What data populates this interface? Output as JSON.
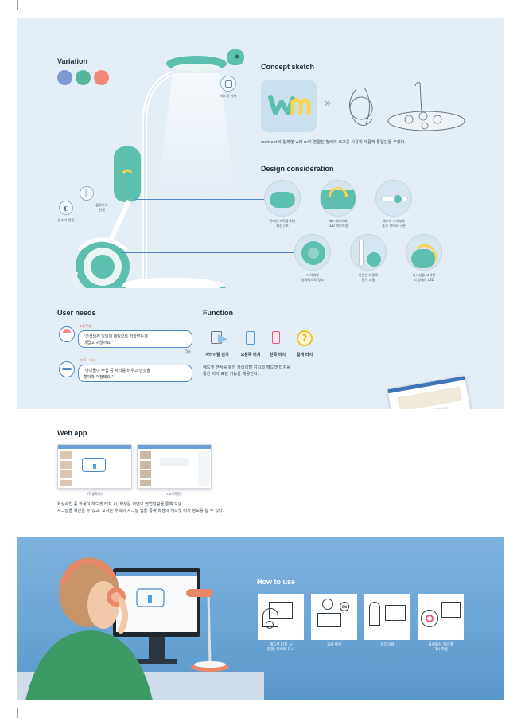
{
  "variation": {
    "title": "Variation",
    "colors": [
      "#7e9ad3",
      "#58b59d",
      "#f0897a"
    ]
  },
  "product": {
    "headset_label": "헤드셋 거치",
    "bluetooth_label": "블루투스 연결",
    "mute_label": "음소거 알림"
  },
  "concept": {
    "title": "Concept sketch",
    "logo_text": "wm",
    "arrow": "»",
    "caption": "wemeet의 알파벳 w와 m이 연결된 형태의 로고를 사용해 제품에 통일감을 주었다."
  },
  "design": {
    "title": "Design consideration",
    "items": [
      {
        "label_1": "편리한 조작을 위한",
        "label_2": "회전구조"
      },
      {
        "label_1": "헤드셋터치와",
        "label_2": "LED 레이어링"
      },
      {
        "label_1": "헤드셋 거치부분",
        "label_2": "홈과 색으로 구분"
      },
      {
        "label_1": "터치패널",
        "label_2": "일체적으로 강조"
      },
      {
        "label_1": "유연한 재질로",
        "label_2": "길이 조절"
      },
      {
        "label_1": "가시성을 고려한",
        "label_2": "띠 형태의 LED"
      }
    ]
  },
  "user_needs": {
    "title": "User needs",
    "student_label": "초등학생",
    "student_quote_1": "\"선생님께 일일이 채팅으로 허락받는게",
    "student_quote_2": "어렵고 귀찮아요.\"",
    "parent_label": "부모, 교사",
    "parent_quote_1": "\"아이들이 수업 중 자리를 비우고 딴짓을",
    "parent_quote_2": "할까봐 걱정돼요.\"",
    "arrow": "»"
  },
  "function": {
    "title": "Function",
    "items": [
      "자리이탈 감지",
      "오른쪽 터치",
      "왼쪽 터치",
      "길게 터치"
    ],
    "desc_1": "헤드셋 센서를 통한 자리이탈 감지와 헤드셋 터치를",
    "desc_2": "통한 의사 표현 기능을 제공한다."
  },
  "webapp": {
    "title": "Web app",
    "student_screen": "<학생화면>",
    "teacher_screen": "<교사화면>",
    "desc_1": "화상수업 중 학생이 헤드셋 터치 시, 학생은 화면의 팝업알림을 통해 보낸",
    "desc_2": "시그널을 확인할 수 있고, 교사는 우측의 시그널 탭을 통해 학생의 헤드셋 터치 정보를 알 수 있다."
  },
  "howto": {
    "title": "How to use",
    "steps": [
      {
        "label_1": "헤드셋 터치 시",
        "label_2": "팝업, 라이트 표시"
      },
      {
        "label_1": "교사 확인",
        "label_2": ""
      },
      {
        "label_1": "자리이탈",
        "label_2": ""
      },
      {
        "label_1": "돌아와서 헤드셋",
        "label_2": "다시 착용"
      }
    ],
    "ok_badge": "OK"
  },
  "accent": {
    "mint": "#5dbfae",
    "blue": "#3f74b8",
    "panel": "#e4eef7"
  }
}
